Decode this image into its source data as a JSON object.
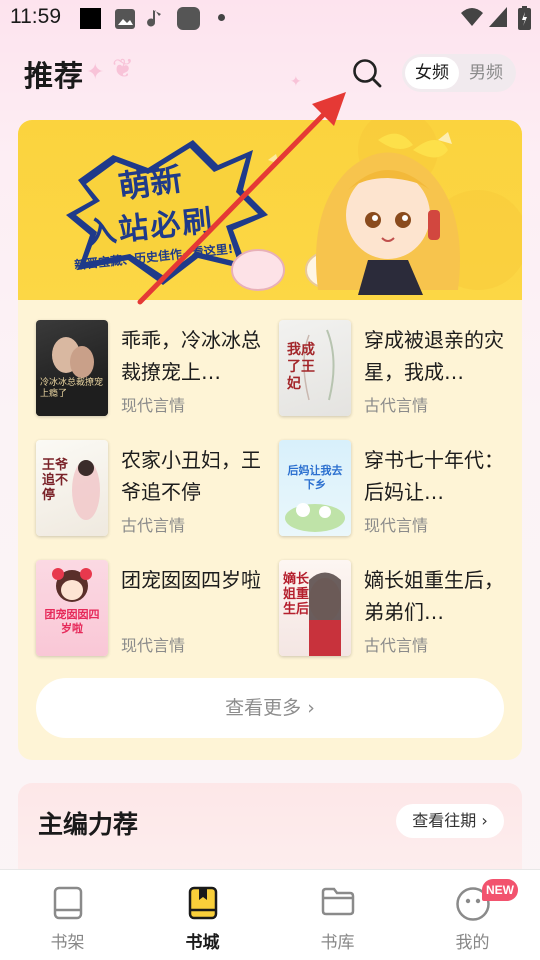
{
  "status_bar": {
    "time": "11:59"
  },
  "header": {
    "title": "推荐"
  },
  "gender_toggle": {
    "female": "女频",
    "male": "男频"
  },
  "banner": {
    "headline_line1": "萌新",
    "headline_line2": "入站必刷",
    "tagline": "新晋宝藏、历史佳作~看这里!"
  },
  "books": [
    {
      "title": "乖乖，冷冰冰总裁撩宠上…",
      "genre": "现代言情",
      "cover_text": "冷冰冰总裁撩宠上瘾了"
    },
    {
      "title": "穿成被退亲的灾星，我成…",
      "genre": "古代言情",
      "cover_text": "我成了王妃"
    },
    {
      "title": "农家小丑妇，王爷追不停",
      "genre": "古代言情",
      "cover_text": "王爷追不停"
    },
    {
      "title": "穿书七十年代：后妈让…",
      "genre": "现代言情",
      "cover_text": "后妈让我去下乡"
    },
    {
      "title": "团宠囡囡四岁啦",
      "genre": "现代言情",
      "cover_text": "团宠囡囡四岁啦"
    },
    {
      "title": "嫡长姐重生后，弟弟们…",
      "genre": "古代言情",
      "cover_text": "嫡长姐重生后"
    }
  ],
  "more_button": "查看更多 ›",
  "editor_section": {
    "title": "主编力荐",
    "past_button": "查看往期 ›"
  },
  "nav": [
    {
      "label": "书架"
    },
    {
      "label": "书城"
    },
    {
      "label": "书库"
    },
    {
      "label": "我的"
    }
  ],
  "badge": "NEW",
  "colors": {
    "banner_yellow": "#fbd33e",
    "card_bg": "#fef4d6",
    "badge_red": "#f2536e",
    "arrow_red": "#e53935"
  }
}
